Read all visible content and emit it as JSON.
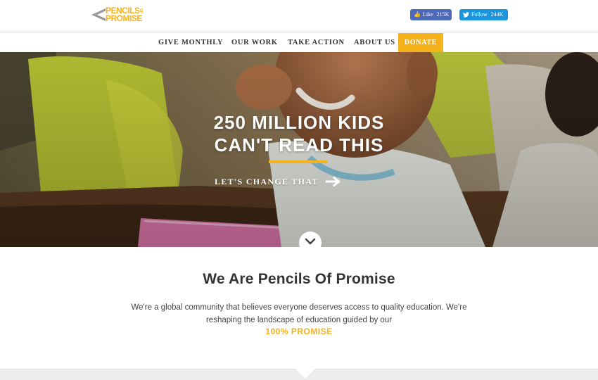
{
  "header": {
    "logo": {
      "line1": "PENCILS",
      "small": "OF",
      "line2": "PROMISE"
    },
    "social": {
      "facebook": {
        "label": "Like",
        "count": "215K",
        "icon": "thumbs-up-icon"
      },
      "twitter": {
        "label": "Follow",
        "count": "244K",
        "icon": "twitter-bird-icon"
      }
    }
  },
  "nav": {
    "items": [
      {
        "label": "GIVE MONTHLY"
      },
      {
        "label": "OUR WORK"
      },
      {
        "label": "TAKE ACTION"
      },
      {
        "label": "ABOUT US"
      }
    ],
    "donate": "DONATE"
  },
  "hero": {
    "title_line1": "250 MILLION KIDS",
    "title_line2": "CAN'T READ THIS",
    "cta": "LET'S CHANGE THAT",
    "cta_icon": "arrow-right-icon",
    "scroll_icon": "chevron-down-icon"
  },
  "intro": {
    "title": "We Are Pencils Of Promise",
    "text_line1": "We're a global community that believes everyone deserves access to quality education. We're",
    "text_line2": "reshaping the landscape of education guided by our",
    "link": "100% PROMISE"
  },
  "colors": {
    "brand_yellow": "#f6b21b",
    "facebook_blue": "#4c69ba",
    "twitter_blue": "#1b95e0",
    "text_dark": "#333333"
  }
}
